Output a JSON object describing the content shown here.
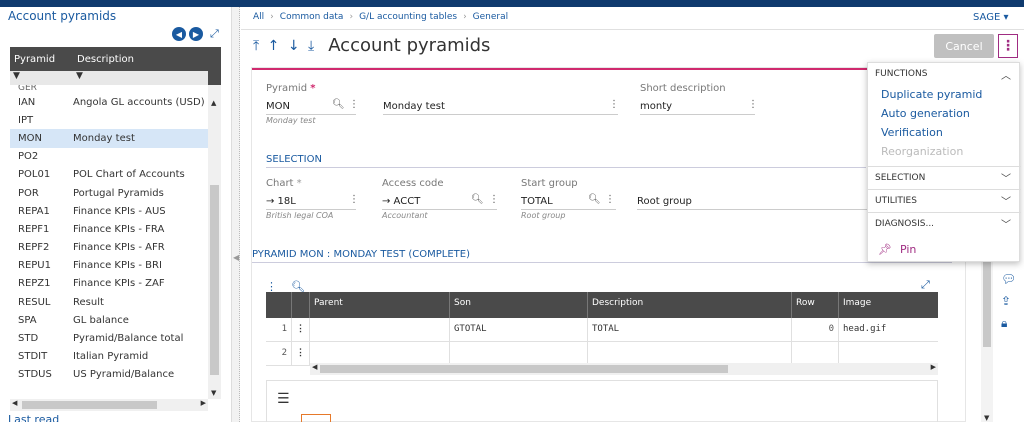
{
  "left_panel": {
    "title": "Account pyramids",
    "nav_prev": "◀",
    "nav_next": "▶",
    "expand": "⤢",
    "columns": [
      "Pyramid",
      "Description"
    ],
    "filter_icon": "▼",
    "partial_row": "GER",
    "rows": [
      {
        "code": "IAN",
        "desc": "Angola GL accounts (USD)"
      },
      {
        "code": "IPT",
        "desc": ""
      },
      {
        "code": "MON",
        "desc": "Monday test",
        "selected": true
      },
      {
        "code": "PO2",
        "desc": ""
      },
      {
        "code": "POL01",
        "desc": "POL Chart of Accounts"
      },
      {
        "code": "POR",
        "desc": "Portugal Pyramids"
      },
      {
        "code": "REPA1",
        "desc": "Finance KPIs - AUS"
      },
      {
        "code": "REPF1",
        "desc": "Finance KPIs - FRA"
      },
      {
        "code": "REPF2",
        "desc": "Finance KPIs - AFR"
      },
      {
        "code": "REPU1",
        "desc": "Finance KPIs - BRI"
      },
      {
        "code": "REPZ1",
        "desc": "Finance KPIs - ZAF"
      },
      {
        "code": "RESUL",
        "desc": "Result"
      },
      {
        "code": "SPA",
        "desc": "GL balance"
      },
      {
        "code": "STD",
        "desc": "Pyramid/Balance total"
      },
      {
        "code": "STDIT",
        "desc": "Italian Pyramid"
      },
      {
        "code": "STDUS",
        "desc": "US Pyramid/Balance"
      }
    ],
    "last_read": "Last read"
  },
  "breadcrumb": [
    "All",
    "Common data",
    "G/L accounting tables",
    "General"
  ],
  "user_menu": "SAGE ▾",
  "page_title": "Account pyramids",
  "nav_arrows": "⤒ ↑ ↓ ⤓",
  "cancel_label": "Cancel",
  "kebab": "⋮",
  "form": {
    "pyramid_label": "Pyramid",
    "pyramid_value": "MON",
    "pyramid_sub": "Monday test",
    "desc_value": "Monday test",
    "short_label": "Short description",
    "short_value": "monty",
    "selection_title": "SELECTION",
    "chart_label": "Chart",
    "chart_value": "→ 18L",
    "chart_sub": "British legal COA",
    "access_label": "Access code",
    "access_value": "→ ACCT",
    "access_sub": "Accountant",
    "start_label": "Start group",
    "start_value": "TOTAL",
    "start_sub": "Root group",
    "root_value": "Root group",
    "pyramid_section": "PYRAMID MON : MONDAY TEST (COMPLETE)"
  },
  "table": {
    "headers": [
      "Parent",
      "Son",
      "Description",
      "Row",
      "Image"
    ],
    "rows": [
      {
        "n": "1",
        "parent": "",
        "son": "GTOTAL",
        "desc": "TOTAL",
        "row": "0",
        "image": "head.gif"
      },
      {
        "n": "2",
        "parent": "",
        "son": "",
        "desc": "",
        "row": "",
        "image": ""
      }
    ]
  },
  "menu": {
    "functions": "FUNCTIONS",
    "items": [
      "Duplicate pyramid",
      "Auto generation",
      "Verification",
      "Reorganization"
    ],
    "selection": "SELECTION",
    "utilities": "UTILITIES",
    "diagnosis": "DIAGNOSIS...",
    "pin": "Pin"
  }
}
